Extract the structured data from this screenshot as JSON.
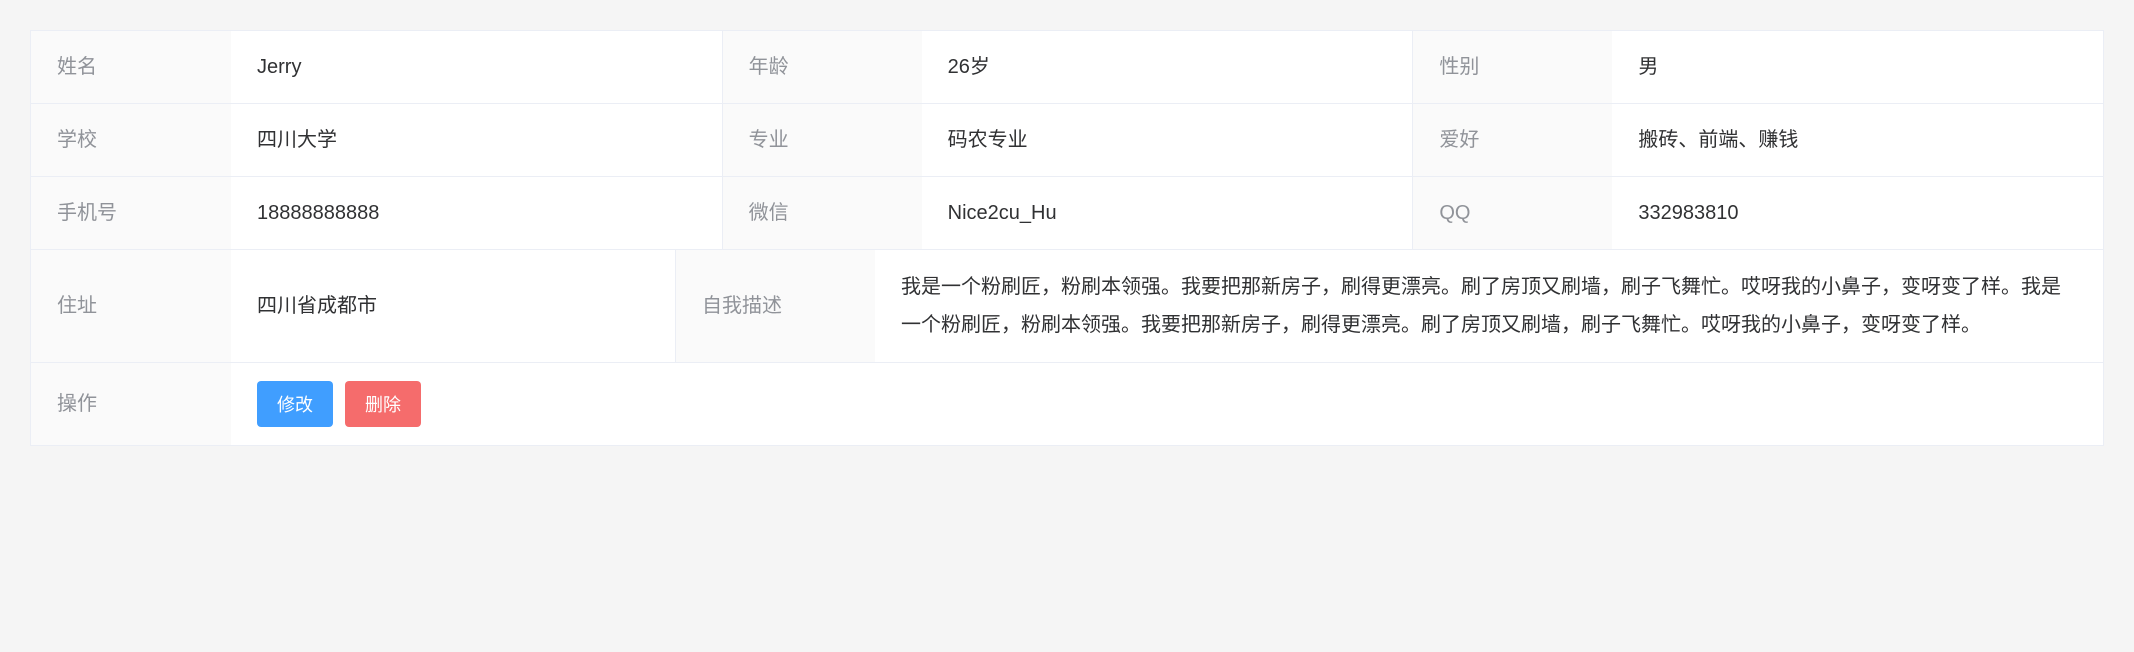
{
  "labels": {
    "name": "姓名",
    "age": "年龄",
    "gender": "性别",
    "school": "学校",
    "major": "专业",
    "hobby": "爱好",
    "phone": "手机号",
    "wechat": "微信",
    "qq": "QQ",
    "address": "住址",
    "description": "自我描述",
    "action": "操作"
  },
  "values": {
    "name": "Jerry",
    "age": "26岁",
    "gender": "男",
    "school": "四川大学",
    "major": "码农专业",
    "hobby": "搬砖、前端、赚钱",
    "phone": "18888888888",
    "wechat": "Nice2cu_Hu",
    "qq": "332983810",
    "address": "四川省成都市",
    "description": "我是一个粉刷匠，粉刷本领强。我要把那新房子，刷得更漂亮。刷了房顶又刷墙，刷子飞舞忙。哎呀我的小鼻子，变呀变了样。我是一个粉刷匠，粉刷本领强。我要把那新房子，刷得更漂亮。刷了房顶又刷墙，刷子飞舞忙。哎呀我的小鼻子，变呀变了样。"
  },
  "buttons": {
    "edit": "修改",
    "delete": "删除"
  }
}
